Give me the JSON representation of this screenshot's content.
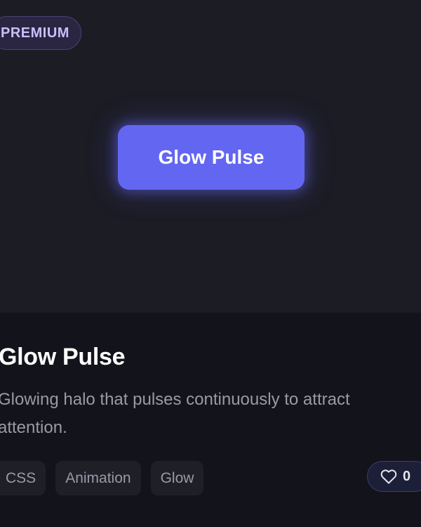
{
  "badge": {
    "label": "PREMIUM"
  },
  "preview": {
    "button_label": "Glow Pulse"
  },
  "card": {
    "title": "Glow Pulse",
    "description": "Glowing halo that pulses continuously to attract attention.",
    "tags": [
      "CSS",
      "Animation",
      "Glow"
    ],
    "likes": {
      "count": "0",
      "icon": "heart-icon"
    }
  },
  "colors": {
    "accent": "#6366f1",
    "badge_text": "#c9befa",
    "preview_bg": "#1c1c25",
    "card_bg": "#13131b"
  }
}
